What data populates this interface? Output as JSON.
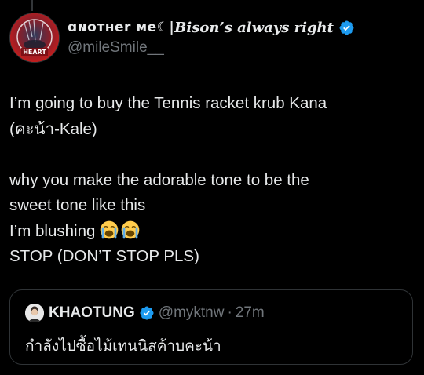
{
  "tweet": {
    "author": {
      "display_name_prefix": "ɑɴoᴛнer мe☾|",
      "display_name_suffix": "Bison’s always right",
      "handle": "@mileSmile__",
      "avatar_badge_text": "HEART",
      "verified": true
    },
    "body": {
      "paragraph_1": [
        "I’m going to buy the Tennis racket krub Kana",
        "(คะน้า-Kale)"
      ],
      "paragraph_2": [
        "why you make the adorable tone to be the",
        "sweet tone like this",
        "I’m blushing",
        "STOP (DON’T STOP PLS)"
      ],
      "emojis": [
        "loudly-crying-face",
        "loudly-crying-face"
      ]
    },
    "quoted_tweet": {
      "display_name": "KHAOTUNG",
      "handle": "@myktnw",
      "separator": "·",
      "time": "27m",
      "text": "กำลังไปซื้อไม้เทนนิสค้าบคะน้า",
      "verified": true
    }
  },
  "colors": {
    "background": "#000000",
    "text_primary": "#e7e9ea",
    "text_secondary": "#71767b",
    "border": "#2f3336",
    "verified_blue": "#1d9bf0"
  }
}
